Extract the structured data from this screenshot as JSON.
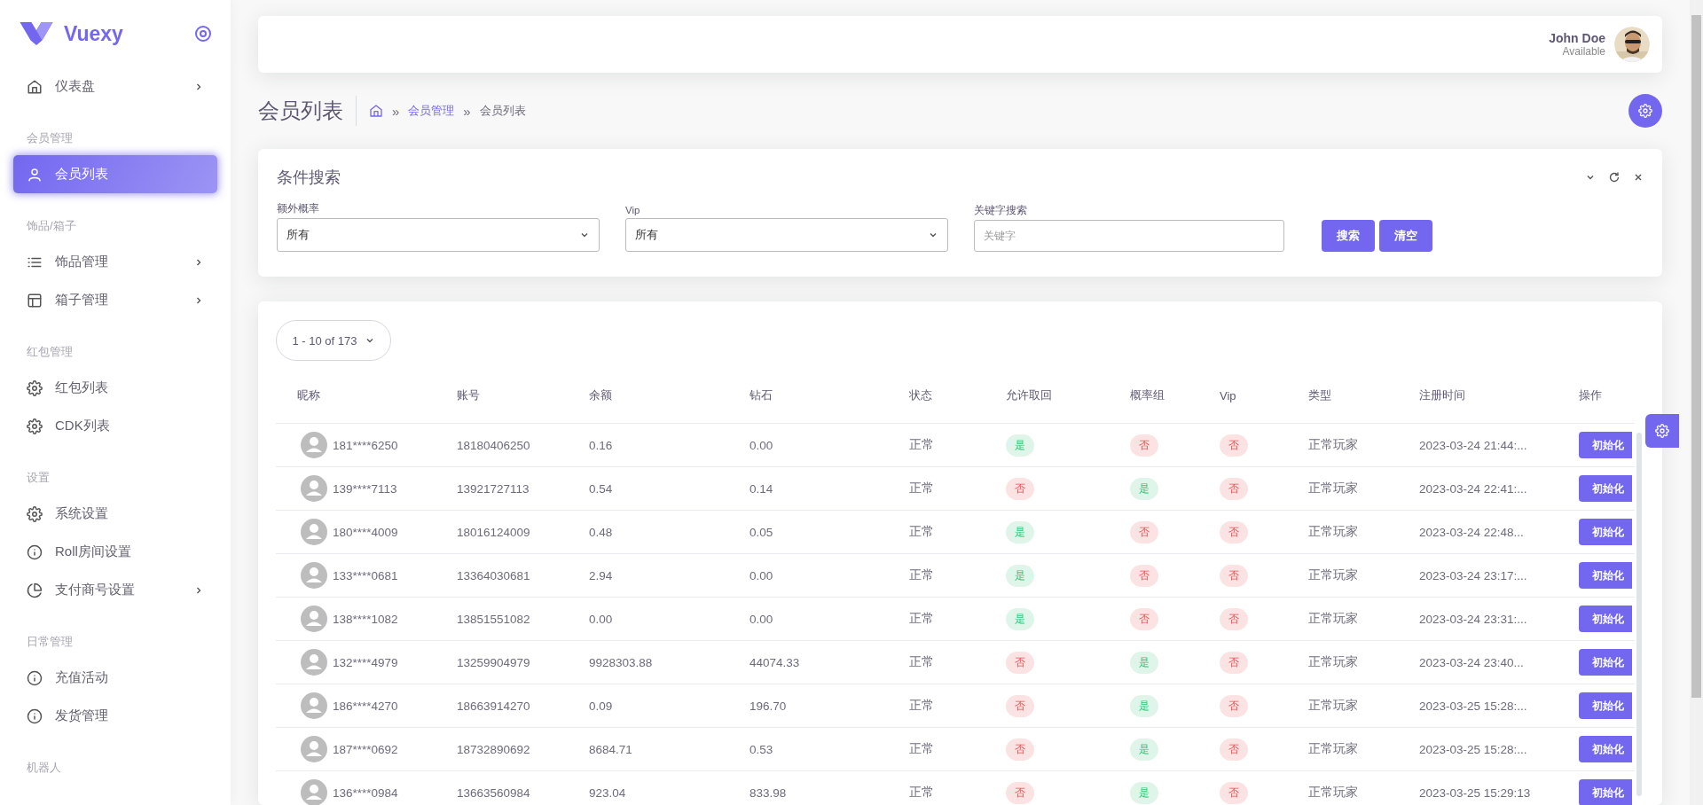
{
  "brand": {
    "name": "Vuexy"
  },
  "sidebar": {
    "sections": [
      {
        "items": [
          {
            "label": "仪表盘",
            "kind": "home",
            "has_submenu": true,
            "selected": false
          }
        ]
      },
      {
        "heading": "会员管理",
        "items": [
          {
            "label": "会员列表",
            "kind": "user",
            "has_submenu": false,
            "selected": true
          }
        ]
      },
      {
        "heading": "饰品/箱子",
        "items": [
          {
            "label": "饰品管理",
            "kind": "list",
            "has_submenu": true,
            "selected": false
          },
          {
            "label": "箱子管理",
            "kind": "layout",
            "has_submenu": true,
            "selected": false
          }
        ]
      },
      {
        "heading": "红包管理",
        "items": [
          {
            "label": "红包列表",
            "kind": "gear",
            "has_submenu": false,
            "selected": false
          },
          {
            "label": "CDK列表",
            "kind": "gear",
            "has_submenu": false,
            "selected": false
          }
        ]
      },
      {
        "heading": "设置",
        "items": [
          {
            "label": "系统设置",
            "kind": "gear",
            "has_submenu": false,
            "selected": false
          },
          {
            "label": "Roll房间设置",
            "kind": "info",
            "has_submenu": false,
            "selected": false
          },
          {
            "label": "支付商号设置",
            "kind": "pie",
            "has_submenu": true,
            "selected": false
          }
        ]
      },
      {
        "heading": "日常管理",
        "items": [
          {
            "label": "充值活动",
            "kind": "info",
            "has_submenu": false,
            "selected": false
          },
          {
            "label": "发货管理",
            "kind": "info",
            "has_submenu": false,
            "selected": false
          }
        ]
      },
      {
        "heading": "机器人"
      }
    ]
  },
  "user": {
    "name": "John Doe",
    "status": "Available"
  },
  "page": {
    "title": "会员列表",
    "separator": "»",
    "breadcrumbs": [
      {
        "label": "会员管理",
        "link": true
      },
      {
        "label": "会员列表",
        "link": false
      }
    ]
  },
  "search": {
    "title": "条件搜索",
    "fields": [
      {
        "label": "额外概率",
        "kind": "select",
        "value": "所有"
      },
      {
        "label": "Vip",
        "kind": "select",
        "value": "所有"
      },
      {
        "label": "关键字搜索",
        "kind": "text",
        "placeholder": "关键字"
      }
    ],
    "buttons": [
      "搜索",
      "清空"
    ]
  },
  "table": {
    "pager": "1 - 10 of 173",
    "columns": [
      "昵称",
      "账号",
      "余额",
      "钻石",
      "状态",
      "允许取回",
      "概率组",
      "Vip",
      "类型",
      "注册时间",
      "操作"
    ],
    "rows": [
      {
        "nickname": "181****6250",
        "account": "18180406250",
        "balance": "0.16",
        "diamonds": "0.00",
        "status": "正常",
        "retrieve": {
          "text": "是",
          "kind": "yes"
        },
        "odds": {
          "text": "否",
          "kind": "no"
        },
        "vip": {
          "text": "否",
          "kind": "no"
        },
        "type": "正常玩家",
        "registered": "2023-03-24 21:44:...",
        "action": "初始化"
      },
      {
        "nickname": "139****7113",
        "account": "13921727113",
        "balance": "0.54",
        "diamonds": "0.14",
        "status": "正常",
        "retrieve": {
          "text": "否",
          "kind": "no"
        },
        "odds": {
          "text": "是",
          "kind": "yes"
        },
        "vip": {
          "text": "否",
          "kind": "no"
        },
        "type": "正常玩家",
        "registered": "2023-03-24 22:41:...",
        "action": "初始化"
      },
      {
        "nickname": "180****4009",
        "account": "18016124009",
        "balance": "0.48",
        "diamonds": "0.05",
        "status": "正常",
        "retrieve": {
          "text": "是",
          "kind": "yes"
        },
        "odds": {
          "text": "否",
          "kind": "no"
        },
        "vip": {
          "text": "否",
          "kind": "no"
        },
        "type": "正常玩家",
        "registered": "2023-03-24 22:48...",
        "action": "初始化"
      },
      {
        "nickname": "133****0681",
        "account": "13364030681",
        "balance": "2.94",
        "diamonds": "0.00",
        "status": "正常",
        "retrieve": {
          "text": "是",
          "kind": "yes"
        },
        "odds": {
          "text": "否",
          "kind": "no"
        },
        "vip": {
          "text": "否",
          "kind": "no"
        },
        "type": "正常玩家",
        "registered": "2023-03-24 23:17:...",
        "action": "初始化"
      },
      {
        "nickname": "138****1082",
        "account": "13851551082",
        "balance": "0.00",
        "diamonds": "0.00",
        "status": "正常",
        "retrieve": {
          "text": "是",
          "kind": "yes"
        },
        "odds": {
          "text": "否",
          "kind": "no"
        },
        "vip": {
          "text": "否",
          "kind": "no"
        },
        "type": "正常玩家",
        "registered": "2023-03-24 23:31:...",
        "action": "初始化"
      },
      {
        "nickname": "132****4979",
        "account": "13259904979",
        "balance": "9928303.88",
        "diamonds": "44074.33",
        "status": "正常",
        "retrieve": {
          "text": "否",
          "kind": "no"
        },
        "odds": {
          "text": "是",
          "kind": "yes"
        },
        "vip": {
          "text": "否",
          "kind": "no"
        },
        "type": "正常玩家",
        "registered": "2023-03-24 23:40...",
        "action": "初始化"
      },
      {
        "nickname": "186****4270",
        "account": "18663914270",
        "balance": "0.09",
        "diamonds": "196.70",
        "status": "正常",
        "retrieve": {
          "text": "否",
          "kind": "no"
        },
        "odds": {
          "text": "是",
          "kind": "yes"
        },
        "vip": {
          "text": "否",
          "kind": "no"
        },
        "type": "正常玩家",
        "registered": "2023-03-25 15:28:...",
        "action": "初始化"
      },
      {
        "nickname": "187****0692",
        "account": "18732890692",
        "balance": "8684.71",
        "diamonds": "0.53",
        "status": "正常",
        "retrieve": {
          "text": "否",
          "kind": "no"
        },
        "odds": {
          "text": "是",
          "kind": "yes"
        },
        "vip": {
          "text": "否",
          "kind": "no"
        },
        "type": "正常玩家",
        "registered": "2023-03-25 15:28:...",
        "action": "初始化"
      },
      {
        "nickname": "136****0984",
        "account": "13663560984",
        "balance": "923.04",
        "diamonds": "833.98",
        "status": "正常",
        "retrieve": {
          "text": "否",
          "kind": "no"
        },
        "odds": {
          "text": "是",
          "kind": "yes"
        },
        "vip": {
          "text": "否",
          "kind": "no"
        },
        "type": "正常玩家",
        "registered": "2023-03-25 15:29:13",
        "action": "初始化"
      }
    ]
  }
}
